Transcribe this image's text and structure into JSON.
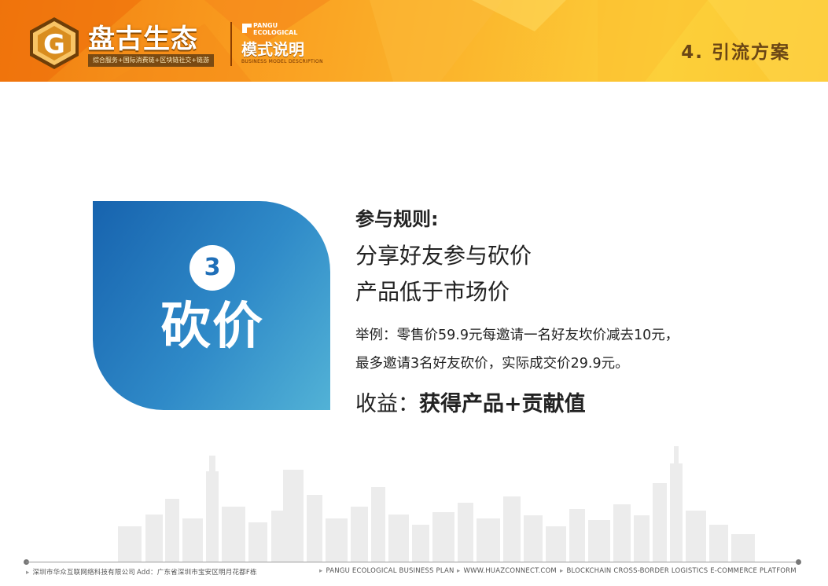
{
  "header": {
    "brand_title": "盘古生态",
    "brand_subtitle": "综合服务+国际消费链+区块链社交+链游",
    "logo_letter": "G",
    "pangu_en_line1": "PANGU",
    "pangu_en_line2": "ECOLOGICAL",
    "model_title": "模式说明",
    "model_subtitle": "BUSINESS MODEL DESCRIPTION",
    "section_title": "4. 引流方案"
  },
  "card": {
    "number": "3",
    "word": "砍价"
  },
  "content": {
    "rules_heading": "参与规则:",
    "rule_line_1": "分享好友参与砍价",
    "rule_line_2": "产品低于市场价",
    "example_line_1": "举例：零售价59.9元每邀请一名好友坎价减去10元，",
    "example_line_2": "最多邀请3名好友砍价，实际成交价29.9元。",
    "benefit_label": "收益：",
    "benefit_value": "获得产品+贡献值"
  },
  "footer": {
    "company": "深圳市华众互联网络科技有限公司",
    "address": "Add：广东省深圳市宝安区明月花都F栋",
    "plan": "PANGU ECOLOGICAL BUSINESS PLAN",
    "website": "WWW.HUAZCONNECT.COM",
    "tagline": "BLOCKCHAIN CROSS-BORDER LOGISTICS E-COMMERCE PLATFORM"
  },
  "colors": {
    "header_orange": "#f99a1e",
    "card_blue": "#1f6fb8",
    "section_title_brown": "#6b4615"
  },
  "icons": {
    "logo": "pangu-g-hexagon-logo",
    "mini_logo": "pangu-mini-logo"
  }
}
